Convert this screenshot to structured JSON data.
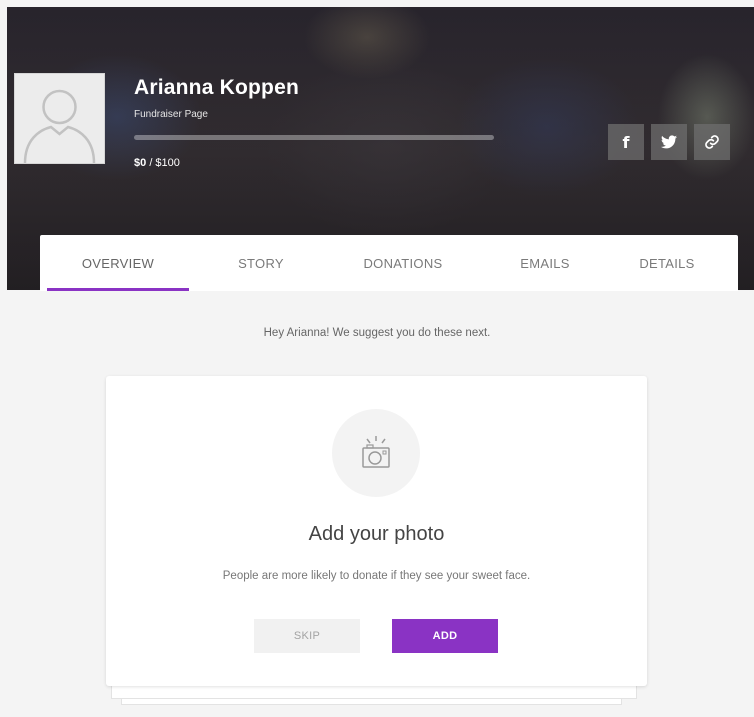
{
  "profile": {
    "name": "Arianna Koppen",
    "subtitle": "Fundraiser Page",
    "raised": "$0",
    "goal": "/ $100",
    "progress_fraction": 0.0
  },
  "social": {
    "facebook_glyph": "f",
    "twitter_glyph": "🐦",
    "link_glyph": "🔗"
  },
  "tabs": [
    {
      "label": "OVERVIEW",
      "active": true
    },
    {
      "label": "STORY",
      "active": false
    },
    {
      "label": "DONATIONS",
      "active": false
    },
    {
      "label": "EMAILS",
      "active": false
    },
    {
      "label": "DETAILS",
      "active": false
    }
  ],
  "suggestion": "Hey Arianna! We suggest you do these next.",
  "card": {
    "title": "Add your photo",
    "description": "People are more likely to donate if they see your sweet face.",
    "skip_label": "SKIP",
    "add_label": "ADD"
  },
  "colors": {
    "accent": "#8a33c4",
    "background": "#f4f4f4"
  }
}
